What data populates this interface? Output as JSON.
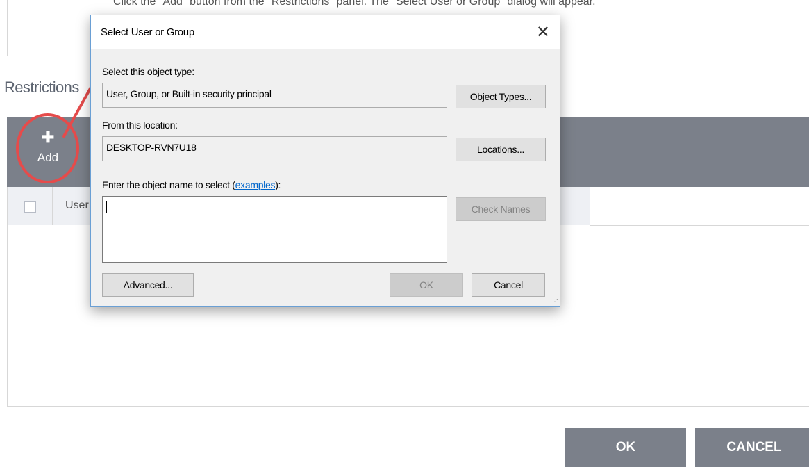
{
  "instruction": "Click the \"Add\" button from the \"Restrictions\" panel. The \"Select User or Group\" dialog will appear.",
  "restrictions": {
    "title": "Restrictions",
    "add_icon": "plus-icon",
    "add_label": "Add",
    "column_user": "User"
  },
  "footer": {
    "ok_label": "OK",
    "cancel_label": "CANCEL"
  },
  "dialog": {
    "title": "Select User or Group",
    "close_icon": "close-icon",
    "object_type_label": "Select this object type:",
    "object_type_value": "User, Group, or Built-in security principal",
    "object_types_button": "Object Types...",
    "location_label": "From this location:",
    "location_value": "DESKTOP-RVN7U18",
    "locations_button": "Locations...",
    "enter_name_label": "Enter the object name to select (",
    "examples_link": "examples",
    "enter_name_suffix": "):",
    "object_name_value": "",
    "check_names_button": "Check Names",
    "advanced_button": "Advanced...",
    "ok_button": "OK",
    "cancel_button": "Cancel"
  },
  "colors": {
    "toolbar": "#7b808a",
    "annotation": "#e54b4b",
    "link": "#0066cc",
    "dialog_border": "#6a9fd4"
  }
}
